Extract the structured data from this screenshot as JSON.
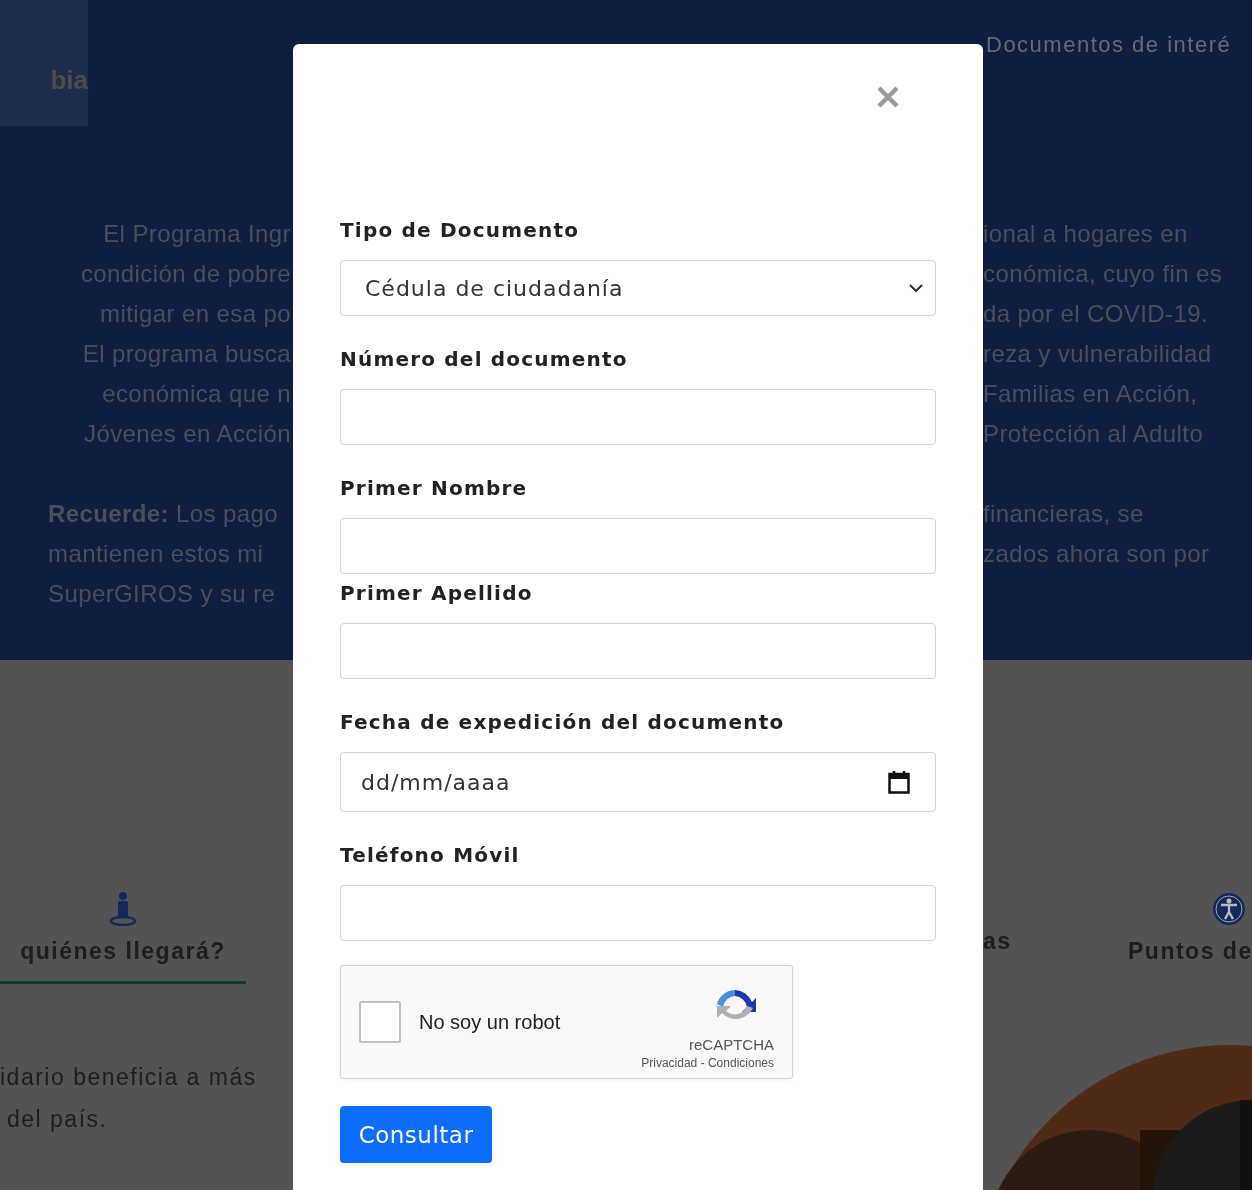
{
  "header": {
    "logo": "bia",
    "nav": [
      {
        "label": "Documentos de interé"
      }
    ]
  },
  "intro": {
    "left_lines": [
      "El Programa Ingr",
      "condición de pobre",
      "mitigar en esa po",
      "El programa busca",
      "económica que n",
      "Jóvenes en Acción"
    ],
    "right_lines": [
      "ional a hogares en",
      "conómica, cuyo fin es",
      "da por el COVID-19.",
      "reza y vulnerabilidad",
      "Familias en Acción,",
      "Protección al Adulto"
    ],
    "note_left": [
      "**Recuerde:** Los pago",
      "mantienen estos mi",
      "SuperGIROS y su re"
    ],
    "note_right": [
      "financieras, se",
      "zados ahora son por"
    ]
  },
  "tabs": [
    {
      "label": "quiénes llegará?",
      "selected": true
    },
    {
      "label": "as",
      "selected": false
    },
    {
      "label": "Puntos de",
      "selected": false
    }
  ],
  "section_text": [
    "idario beneficia a más",
    "del país."
  ],
  "modal": {
    "fields": [
      {
        "kind": "select",
        "label": "Tipo de Documento",
        "value": "Cédula de ciudadanía"
      },
      {
        "kind": "text",
        "label": "Número del documento"
      },
      {
        "kind": "text",
        "label": "Primer Nombre"
      },
      {
        "kind": "text",
        "label": "Primer Apellido"
      },
      {
        "kind": "date",
        "label": "Fecha de expedición del documento",
        "placeholder": "dd/mm/aaaa"
      },
      {
        "kind": "text",
        "label": "Teléfono Móvil"
      }
    ],
    "captcha": {
      "label": "No soy un robot",
      "checked": false,
      "brand": "reCAPTCHA",
      "links": "Privacidad - Condiciones"
    },
    "submit": "Consultar"
  }
}
